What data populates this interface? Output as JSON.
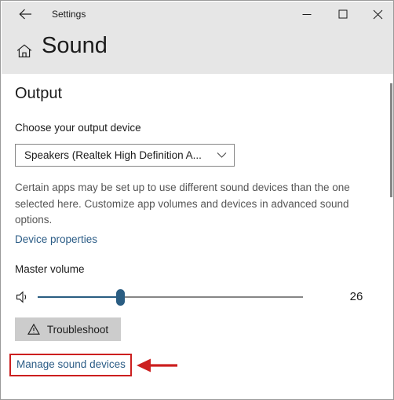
{
  "window": {
    "titlebar": {
      "title": "Settings",
      "back_icon": "back-arrow-icon",
      "minimize_label": "—",
      "maximize_label": "□",
      "close_label": "✕"
    },
    "header": {
      "home_icon": "home-icon",
      "page_title": "Sound"
    }
  },
  "content": {
    "section_heading": "Output",
    "output_device": {
      "label": "Choose your output device",
      "selected_value": "Speakers (Realtek High Definition A...",
      "chevron_icon": "chevron-down-icon"
    },
    "description": "Certain apps may be set up to use different sound devices than the one selected here. Customize app volumes and devices in advanced sound options.",
    "device_properties_link": "Device properties",
    "master_volume": {
      "label": "Master volume",
      "speaker_icon": "speaker-volume-icon",
      "value": "26",
      "min": 0,
      "max": 100
    },
    "troubleshoot": {
      "label": "Troubleshoot",
      "icon": "warning-triangle-icon"
    },
    "manage_sound_devices_link": "Manage sound devices"
  },
  "colors": {
    "accent_link": "#2b5c86",
    "slider_fill": "#2a5d82",
    "header_band": "#e6e6e6",
    "button_face": "#cccccc",
    "annotation_red": "#cc1f1f"
  },
  "annotations": {
    "highlight_box_target": "manage-sound-devices-link",
    "arrow_icon": "left-pointing-arrow-icon"
  }
}
